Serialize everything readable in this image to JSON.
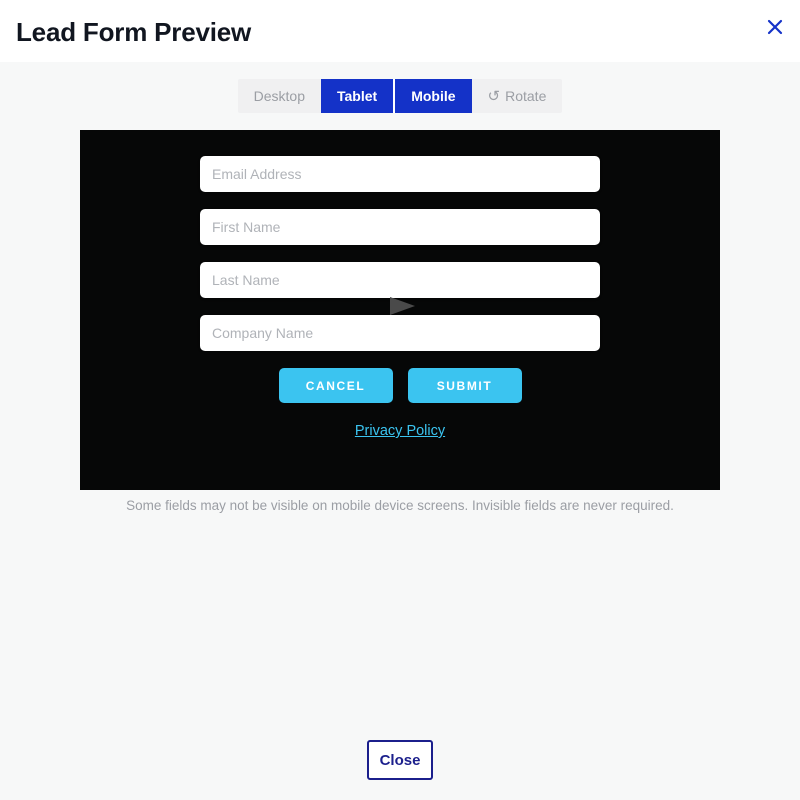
{
  "header": {
    "title": "Lead Form Preview",
    "close_icon": "close-icon"
  },
  "device_toolbar": {
    "buttons": [
      {
        "label": "Desktop",
        "active": false,
        "icon": null
      },
      {
        "label": "Tablet",
        "active": true,
        "icon": null
      },
      {
        "label": "Mobile",
        "active": true,
        "icon": null
      },
      {
        "label": "Rotate",
        "active": false,
        "icon": "↺"
      }
    ],
    "active_color": "#1432c8",
    "inactive_bg": "#f0f0f1",
    "inactive_text": "#9b9ea4"
  },
  "preview": {
    "background": "#060707",
    "fields": [
      {
        "placeholder": "Email Address",
        "value": ""
      },
      {
        "placeholder": "First Name",
        "value": ""
      },
      {
        "placeholder": "Last Name",
        "value": ""
      },
      {
        "placeholder": "Company Name",
        "value": ""
      }
    ],
    "actions": {
      "cancel_label": "CANCEL",
      "submit_label": "SUBMIT",
      "accent_color": "#3bc4f0"
    },
    "privacy_link": "Privacy Policy"
  },
  "helper_note": "Some fields may not be visible on mobile device screens. Invisible fields are never required.",
  "footer": {
    "close_label": "Close",
    "close_color": "#1b1f8c"
  }
}
